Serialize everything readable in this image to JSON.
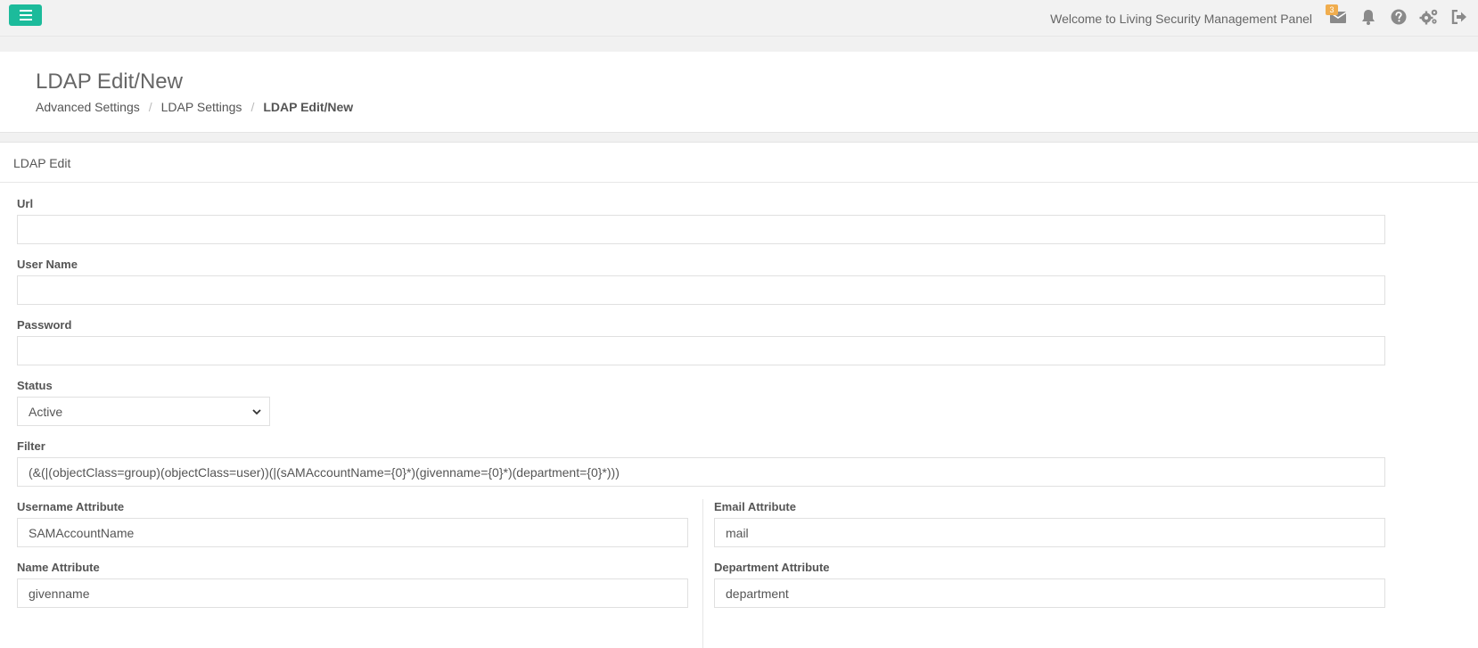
{
  "topbar": {
    "welcome": "Welcome to Living Security Management Panel",
    "mail_badge": "3",
    "icons": [
      "menu-icon",
      "mail-icon",
      "bell-icon",
      "help-icon",
      "gears-icon",
      "logout-icon"
    ]
  },
  "header": {
    "title": "LDAP Edit/New",
    "breadcrumb": [
      "Advanced Settings",
      "LDAP Settings",
      "LDAP Edit/New"
    ]
  },
  "panel": {
    "heading": "LDAP Edit"
  },
  "form": {
    "url": {
      "label": "Url",
      "value": ""
    },
    "username": {
      "label": "User Name",
      "value": ""
    },
    "password": {
      "label": "Password",
      "value": ""
    },
    "status": {
      "label": "Status",
      "value": "Active"
    },
    "filter": {
      "label": "Filter",
      "value": "(&(|(objectClass=group)(objectClass=user))(|(sAMAccountName={0}*)(givenname={0}*)(department={0}*)))"
    },
    "username_attr": {
      "label": "Username Attribute",
      "value": "SAMAccountName"
    },
    "email_attr": {
      "label": "Email Attribute",
      "value": "mail"
    },
    "name_attr": {
      "label": "Name Attribute",
      "value": "givenname"
    },
    "department_attr": {
      "label": "Department Attribute",
      "value": "department"
    }
  },
  "colors": {
    "accent": "#1cbb9b",
    "badge": "#f0ad4e",
    "icon": "#8a8a8a"
  }
}
